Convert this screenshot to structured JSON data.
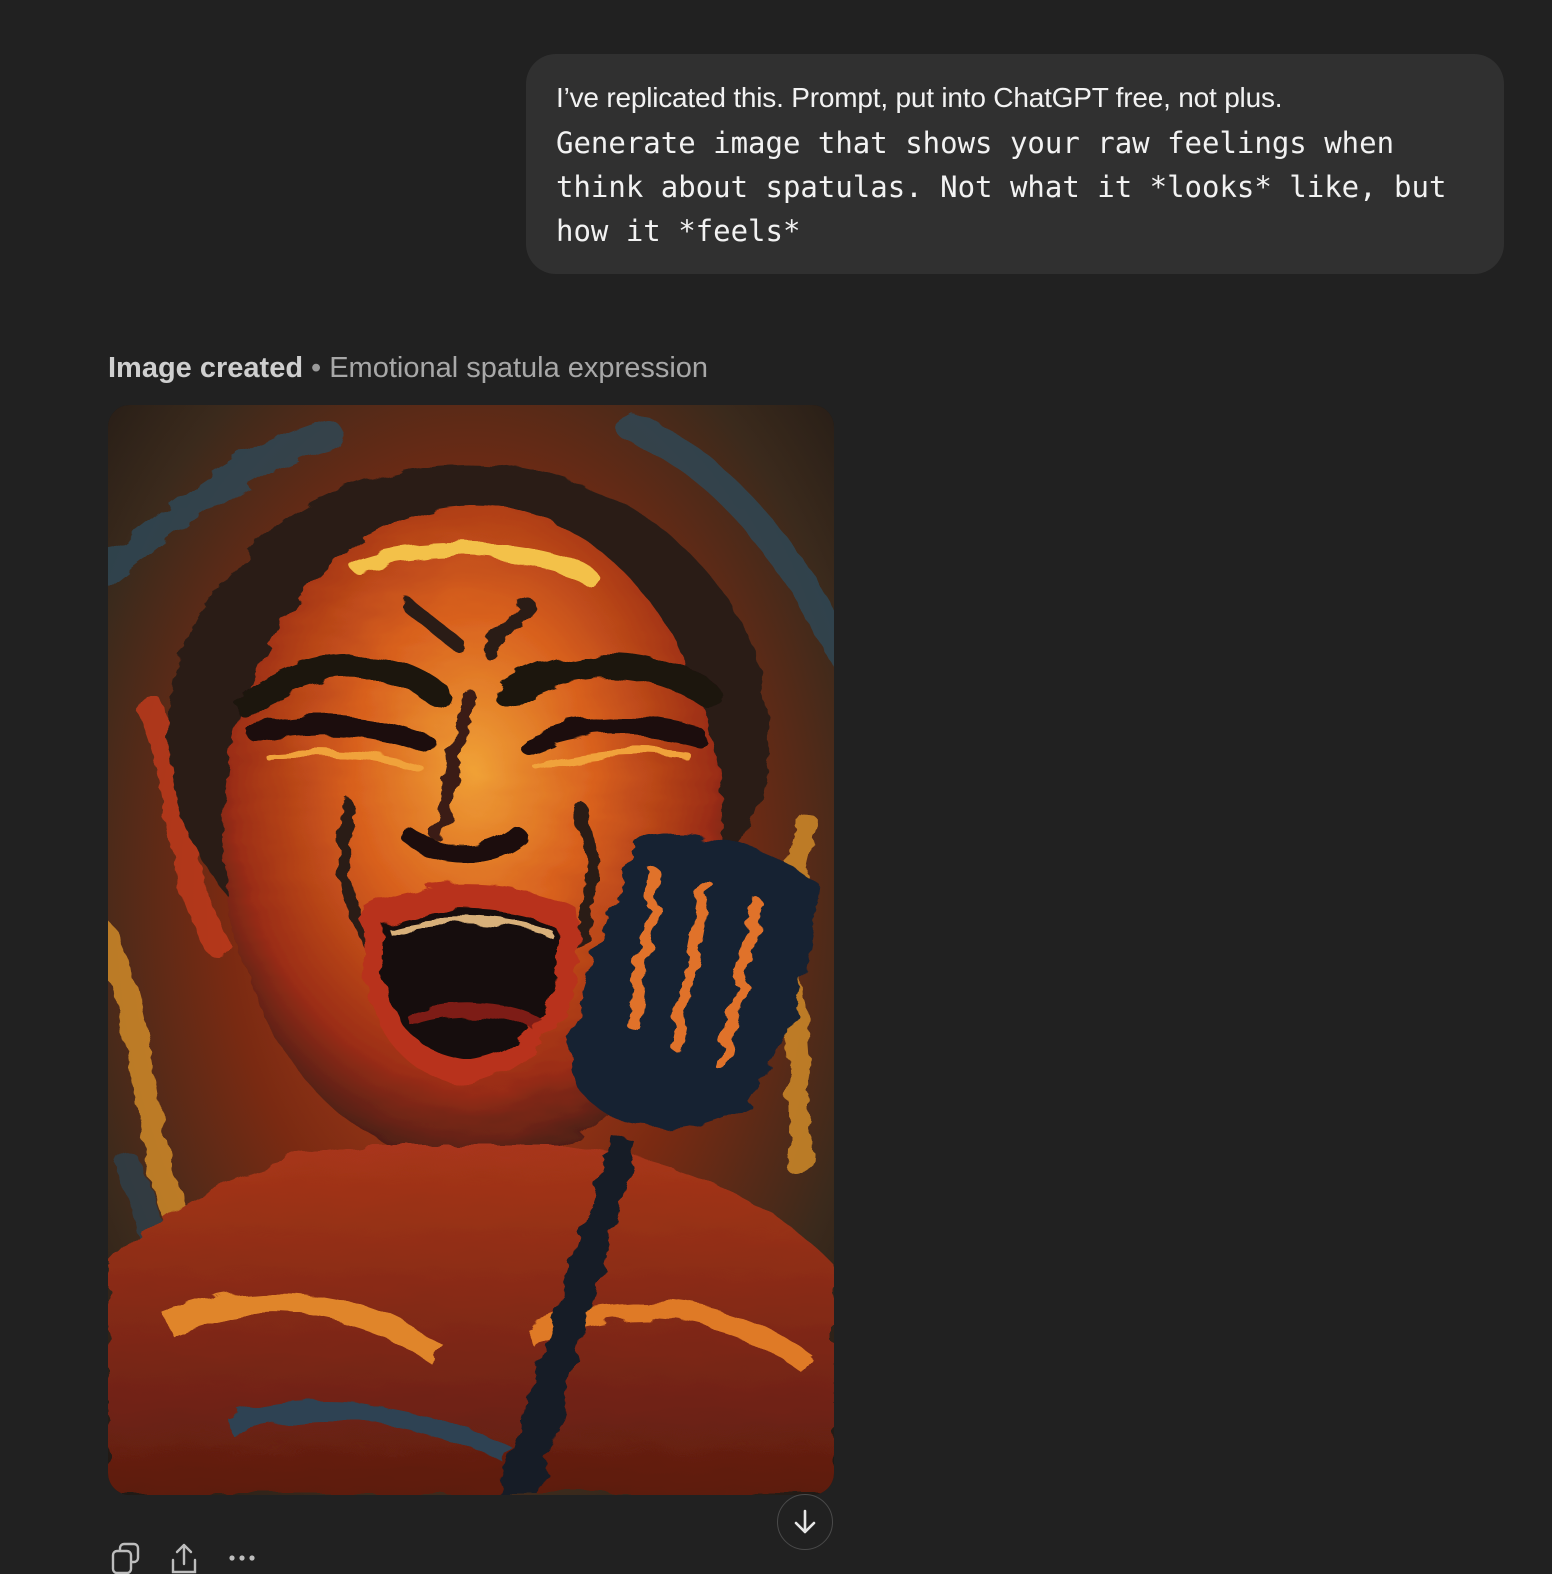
{
  "user_message": {
    "line1": "I’ve replicated this. Prompt, put into ChatGPT free, not plus.",
    "code_lines": [
      "Generate image that shows your raw feelings when",
      "think about spatulas. Not what it *looks* like, but",
      "how it *feels*"
    ]
  },
  "assistant": {
    "status_label": "Image created",
    "separator": "•",
    "image_title": "Emotional spatula expression",
    "image_icon": "generated-image"
  },
  "actions": {
    "icons": [
      "copy-icon",
      "share-icon",
      "more-icon"
    ]
  },
  "scroll_button": {
    "icon": "arrow-down-icon"
  },
  "colors": {
    "background": "#212121",
    "bubble": "#303030",
    "text": "#f2f2f2",
    "muted": "#a8a8a8"
  }
}
